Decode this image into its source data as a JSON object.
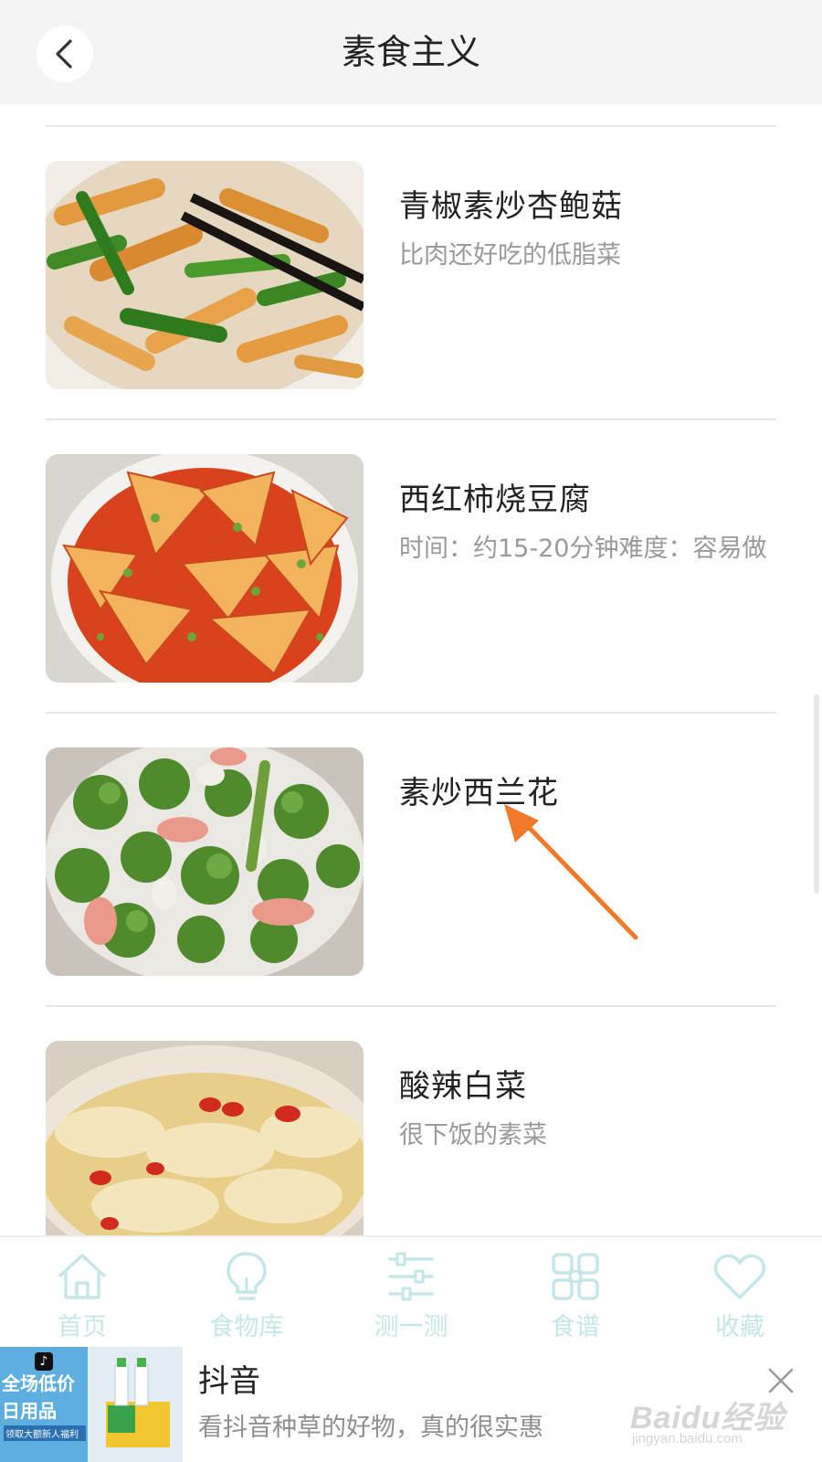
{
  "header": {
    "title": "素食主义",
    "back_icon": "chevron-left-icon"
  },
  "recipes": [
    {
      "title": "青椒素炒杏鲍菇",
      "description": "比肉还好吃的低脂菜",
      "image": "green pepper stir-fried king oyster mushroom"
    },
    {
      "title": "西红柿烧豆腐",
      "description": "时间：约15-20分钟难度：容易做",
      "image": "tomato braised tofu"
    },
    {
      "title": "素炒西兰花",
      "description": "",
      "image": "stir-fried broccoli"
    },
    {
      "title": "酸辣白菜",
      "description": "很下饭的素菜",
      "image": "hot and sour cabbage"
    }
  ],
  "annotation": {
    "color": "#f07a2a"
  },
  "tabbar": {
    "color": "#c6e7e7",
    "tabs": [
      {
        "label": "首页",
        "icon": "home-icon"
      },
      {
        "label": "食物库",
        "icon": "lightbulb-icon"
      },
      {
        "label": "测一测",
        "icon": "sliders-icon"
      },
      {
        "label": "食谱",
        "icon": "grid-icon"
      },
      {
        "label": "收藏",
        "icon": "heart-icon"
      }
    ]
  },
  "ad": {
    "title": "抖音",
    "description": "看抖音种草的好物，真的很实惠",
    "image_text_1": "全场低价",
    "image_text_2": "日用品",
    "image_text_3": "领取大额新人福利",
    "close_icon": "close-icon"
  },
  "watermark": {
    "logo": "Baidu经验",
    "url": "jingyan.baidu.com"
  }
}
